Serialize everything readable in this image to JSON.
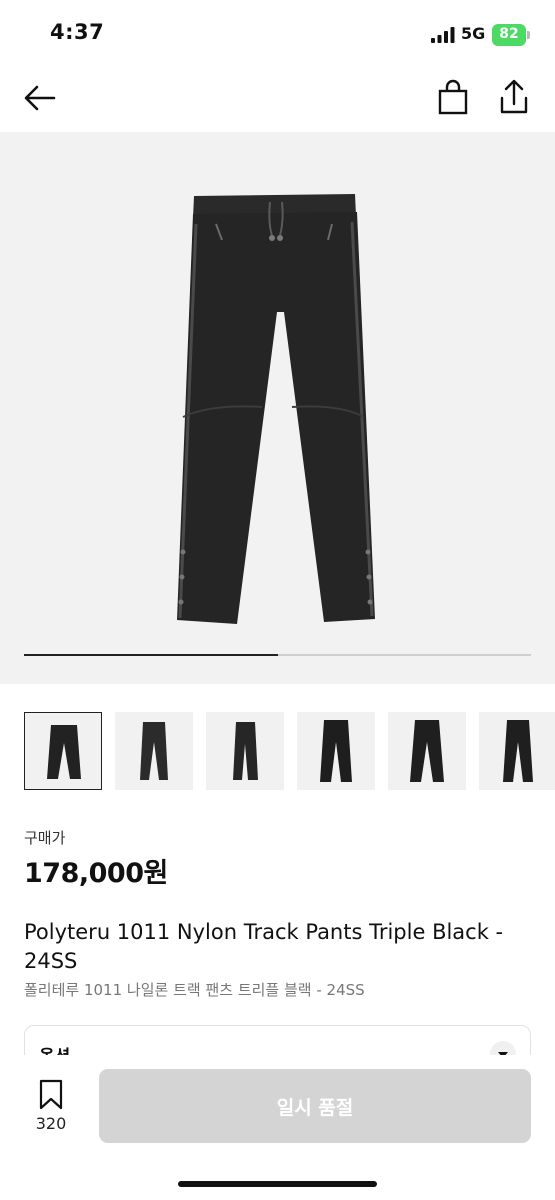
{
  "status_bar": {
    "time": "4:37",
    "network": "5G",
    "battery": "82",
    "battery_color": "#4cd964"
  },
  "nav": {
    "back_icon": "arrow-left-icon",
    "bag_icon": "shopping-bag-icon",
    "share_icon": "share-icon"
  },
  "gallery": {
    "image": "black-nylon-track-pants",
    "progress_fraction": 0.5,
    "thumbnails": [
      {
        "image": "pants-front",
        "selected": true
      },
      {
        "image": "pants-front-model",
        "selected": false
      },
      {
        "image": "pants-side",
        "selected": false
      },
      {
        "image": "pants-model-front",
        "selected": false
      },
      {
        "image": "pants-model-side",
        "selected": false
      },
      {
        "image": "pants-model-back",
        "selected": false
      }
    ]
  },
  "product": {
    "price_label": "구매가",
    "price": "178,000원",
    "title": "Polyteru 1011 Nylon Track Pants Triple Black - 24SS",
    "subtitle": "폴리테루 1011 나일론 트랙 팬츠 트리플 블랙 - 24SS"
  },
  "options": {
    "label": "옵션",
    "chevron_icon": "chevron-down-icon"
  },
  "bottom": {
    "wish_icon": "bookmark-icon",
    "wish_count": "320",
    "soldout_label": "일시 품절"
  }
}
